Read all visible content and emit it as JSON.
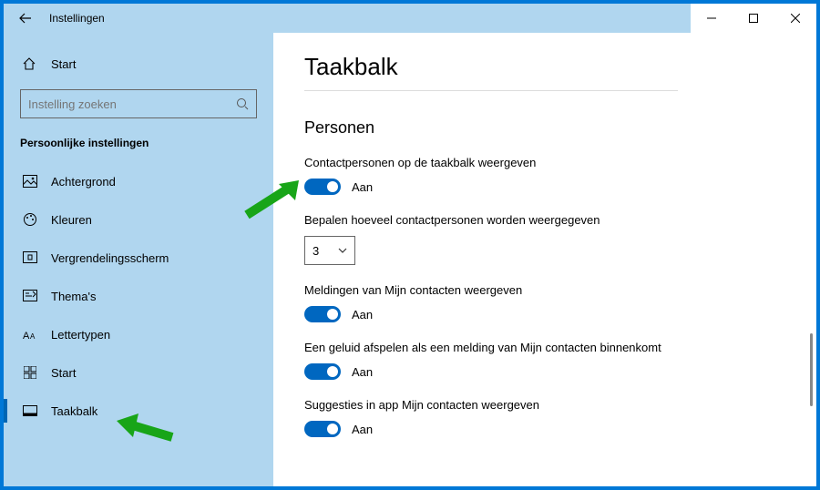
{
  "window": {
    "title": "Instellingen"
  },
  "sidebar": {
    "home_label": "Start",
    "search_placeholder": "Instelling zoeken",
    "section_label": "Persoonlijke instellingen",
    "items": [
      {
        "label": "Achtergrond"
      },
      {
        "label": "Kleuren"
      },
      {
        "label": "Vergrendelingsscherm"
      },
      {
        "label": "Thema's"
      },
      {
        "label": "Lettertypen"
      },
      {
        "label": "Start"
      },
      {
        "label": "Taakbalk"
      }
    ]
  },
  "main": {
    "page_title": "Taakbalk",
    "section_title": "Personen",
    "settings": [
      {
        "label": "Contactpersonen op de taakbalk weergeven",
        "state": "Aan"
      },
      {
        "label": "Bepalen hoeveel contactpersonen worden weergegeven",
        "value": "3"
      },
      {
        "label": "Meldingen van Mijn contacten weergeven",
        "state": "Aan"
      },
      {
        "label": "Een geluid afspelen als een melding van Mijn contacten binnenkomt",
        "state": "Aan"
      },
      {
        "label": "Suggesties in app Mijn contacten weergeven",
        "state": "Aan"
      }
    ]
  }
}
